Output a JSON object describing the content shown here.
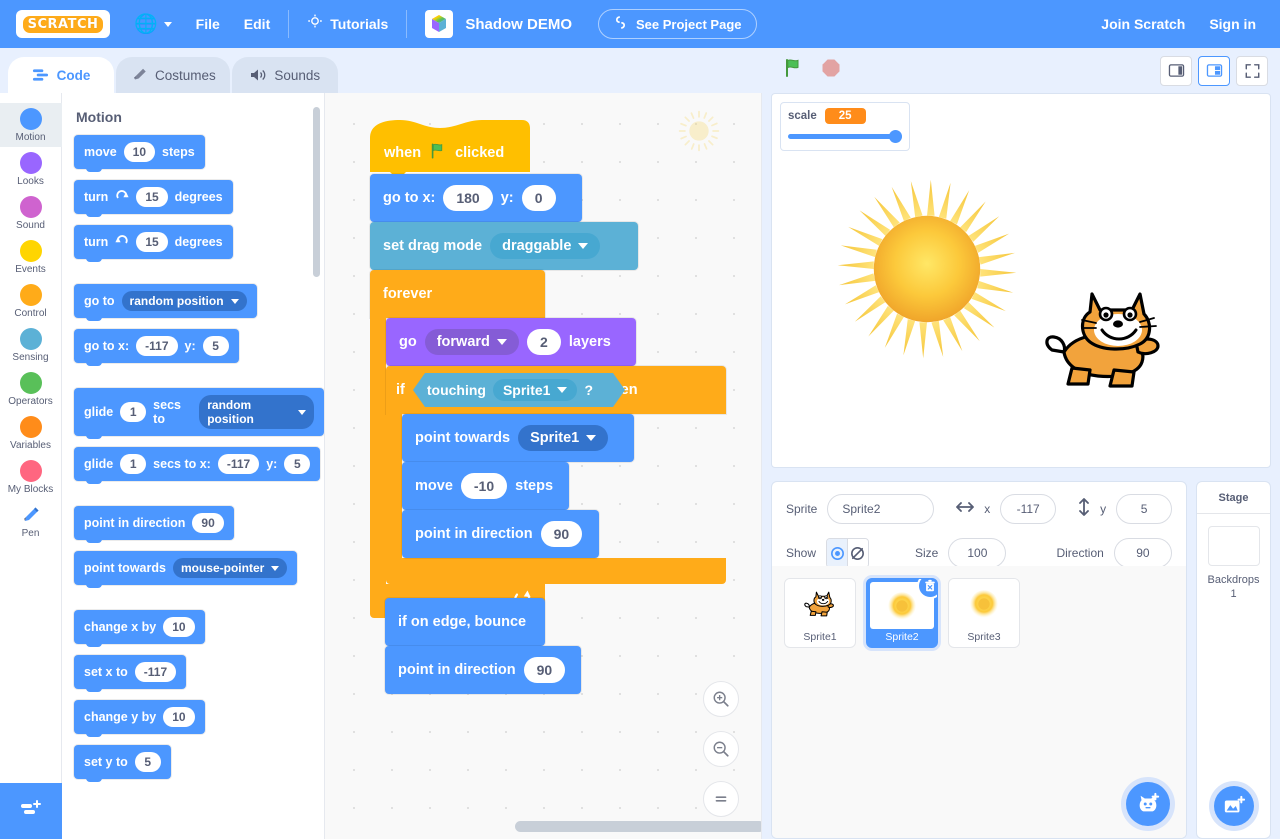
{
  "menubar": {
    "logo_text": "SCRATCH",
    "language_icon": "globe-icon",
    "file_label": "File",
    "edit_label": "Edit",
    "tutorials_icon": "lightbulb-icon",
    "tutorials_label": "Tutorials",
    "project_title": "Shadow DEMO",
    "see_project_page_label": "See Project Page",
    "join_label": "Join Scratch",
    "signin_label": "Sign in",
    "accent_color": "#4c97ff"
  },
  "tabs": [
    {
      "label": "Code",
      "icon": "code-icon",
      "active": true
    },
    {
      "label": "Costumes",
      "icon": "brush-icon",
      "active": false
    },
    {
      "label": "Sounds",
      "icon": "speaker-icon",
      "active": false
    }
  ],
  "stage_controls": {
    "green_flag_icon": "green-flag-icon",
    "stop_icon": "stop-sign-icon",
    "small_stage_icon": "small-stage-icon",
    "large_stage_icon": "large-stage-icon",
    "fullscreen_icon": "fullscreen-icon"
  },
  "categories": [
    {
      "label": "Motion",
      "color": "#4c97ff",
      "selected": true
    },
    {
      "label": "Looks",
      "color": "#9966ff",
      "selected": false
    },
    {
      "label": "Sound",
      "color": "#cf63cf",
      "selected": false
    },
    {
      "label": "Events",
      "color": "#ffd500",
      "selected": false
    },
    {
      "label": "Control",
      "color": "#ffab19",
      "selected": false
    },
    {
      "label": "Sensing",
      "color": "#5cb1d6",
      "selected": false
    },
    {
      "label": "Operators",
      "color": "#59c059",
      "selected": false
    },
    {
      "label": "Variables",
      "color": "#ff8c1a",
      "selected": false
    },
    {
      "label": "My Blocks",
      "color": "#ff6680",
      "selected": false
    },
    {
      "label": "Pen",
      "color": "#0fbd8c",
      "selected": false,
      "icon": "pen-icon"
    }
  ],
  "add_extension_icon": "add-extension-icon",
  "palette": {
    "heading": "Motion",
    "blocks": [
      {
        "id": "move",
        "parts": [
          {
            "t": "text",
            "v": "move"
          },
          {
            "t": "oval",
            "v": "10"
          },
          {
            "t": "text",
            "v": "steps"
          }
        ]
      },
      {
        "id": "turn-right",
        "parts": [
          {
            "t": "text",
            "v": "turn"
          },
          {
            "t": "icon",
            "v": "turn-right-icon"
          },
          {
            "t": "oval",
            "v": "15"
          },
          {
            "t": "text",
            "v": "degrees"
          }
        ]
      },
      {
        "id": "turn-left",
        "parts": [
          {
            "t": "text",
            "v": "turn"
          },
          {
            "t": "icon",
            "v": "turn-left-icon"
          },
          {
            "t": "oval",
            "v": "15"
          },
          {
            "t": "text",
            "v": "degrees"
          }
        ]
      },
      {
        "id": "goto",
        "gap": true,
        "parts": [
          {
            "t": "text",
            "v": "go to"
          },
          {
            "t": "drop",
            "v": "random position"
          }
        ]
      },
      {
        "id": "gotoxy",
        "parts": [
          {
            "t": "text",
            "v": "go to x:"
          },
          {
            "t": "oval",
            "v": "-117"
          },
          {
            "t": "text",
            "v": "y:"
          },
          {
            "t": "oval",
            "v": "5"
          }
        ]
      },
      {
        "id": "glide-to",
        "gap": true,
        "parts": [
          {
            "t": "text",
            "v": "glide"
          },
          {
            "t": "oval",
            "v": "1"
          },
          {
            "t": "text",
            "v": "secs to"
          },
          {
            "t": "drop",
            "v": "random position"
          }
        ]
      },
      {
        "id": "glide-xy",
        "parts": [
          {
            "t": "text",
            "v": "glide"
          },
          {
            "t": "oval",
            "v": "1"
          },
          {
            "t": "text",
            "v": "secs to x:"
          },
          {
            "t": "oval",
            "v": "-117"
          },
          {
            "t": "text",
            "v": "y:"
          },
          {
            "t": "oval",
            "v": "5"
          }
        ]
      },
      {
        "id": "point-dir",
        "gap": true,
        "parts": [
          {
            "t": "text",
            "v": "point in direction"
          },
          {
            "t": "oval",
            "v": "90"
          }
        ]
      },
      {
        "id": "point-to",
        "parts": [
          {
            "t": "text",
            "v": "point towards"
          },
          {
            "t": "drop",
            "v": "mouse-pointer"
          }
        ]
      },
      {
        "id": "change-x",
        "gap": true,
        "parts": [
          {
            "t": "text",
            "v": "change x by"
          },
          {
            "t": "oval",
            "v": "10"
          }
        ]
      },
      {
        "id": "set-x",
        "parts": [
          {
            "t": "text",
            "v": "set x to"
          },
          {
            "t": "oval",
            "v": "-117"
          }
        ]
      },
      {
        "id": "change-y",
        "parts": [
          {
            "t": "text",
            "v": "change y by"
          },
          {
            "t": "oval",
            "v": "10"
          }
        ]
      },
      {
        "id": "set-y",
        "parts": [
          {
            "t": "text",
            "v": "set y to"
          },
          {
            "t": "oval",
            "v": "5"
          }
        ]
      }
    ]
  },
  "script": {
    "hat": {
      "pre": "when",
      "icon": "green-flag-icon",
      "post": "clicked"
    },
    "goto_xy": {
      "label_x": "go to x:",
      "x": "180",
      "label_y": "y:",
      "y": "0"
    },
    "drag_mode": {
      "label": "set drag mode",
      "value": "draggable"
    },
    "forever": {
      "label": "forever"
    },
    "go_layers": {
      "label_go": "go",
      "direction": "forward",
      "count": "2",
      "label_layers": "layers"
    },
    "if_block": {
      "label_if": "if",
      "cond_label": "touching",
      "cond_target": "Sprite1",
      "question": "?",
      "label_then": "then"
    },
    "point_to": {
      "label": "point towards",
      "value": "Sprite1"
    },
    "move": {
      "label": "move",
      "value": "-10",
      "suffix": "steps"
    },
    "point_dir1": {
      "label": "point in direction",
      "value": "90"
    },
    "bounce": {
      "label": "if on edge, bounce"
    },
    "point_dir2": {
      "label": "point in direction",
      "value": "90"
    },
    "loop_arrow_icon": "loop-arrow-icon"
  },
  "zoom_controls": {
    "zoom_in_icon": "zoom-in-icon",
    "zoom_out_icon": "zoom-out-icon",
    "zoom_reset_icon": "zoom-reset-icon"
  },
  "stage": {
    "monitor": {
      "label": "scale",
      "value": "25",
      "slider_percent": 100
    },
    "sprites_on_stage": [
      {
        "name": "sun-sprite",
        "icon": "sun-icon"
      },
      {
        "name": "cat-sprite",
        "icon": "scratch-cat-icon"
      }
    ]
  },
  "sprite_info": {
    "sprite_label": "Sprite",
    "sprite_name": "Sprite2",
    "x_label": "x",
    "x_value": "-117",
    "y_label": "y",
    "y_value": "5",
    "show_label": "Show",
    "show_icon": "eye-icon",
    "hide_icon": "eye-slash-icon",
    "size_label": "Size",
    "size_value": "100",
    "direction_label": "Direction",
    "direction_value": "90"
  },
  "sprites": [
    {
      "name": "Sprite1",
      "icon": "scratch-cat-icon",
      "selected": false
    },
    {
      "name": "Sprite2",
      "icon": "sun-icon",
      "selected": true
    },
    {
      "name": "Sprite3",
      "icon": "sun-icon",
      "selected": false
    }
  ],
  "add_sprite_icon": "add-sprite-icon",
  "stage_selector": {
    "title": "Stage",
    "backdrops_label": "Backdrops",
    "backdrops_count": "1",
    "add_backdrop_icon": "add-backdrop-icon"
  }
}
